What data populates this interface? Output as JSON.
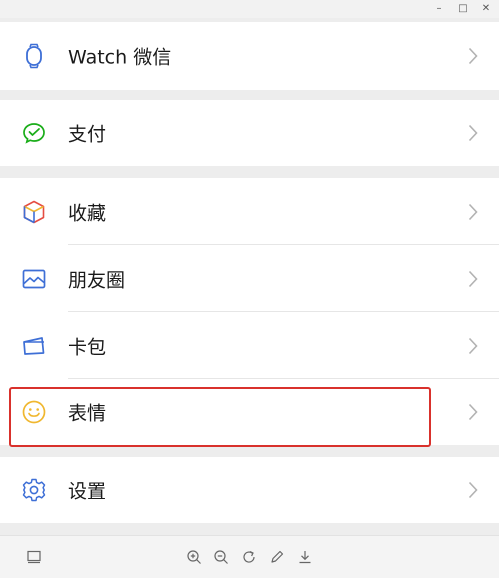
{
  "window": {
    "minimize_glyph": "–",
    "maximize_glyph": "□",
    "close_glyph": "✕"
  },
  "menu": {
    "watch": {
      "label": "Watch 微信",
      "icon": "watch-icon"
    },
    "pay": {
      "label": "支付",
      "icon": "wechat-pay-icon"
    },
    "favorites": {
      "label": "收藏",
      "icon": "cube-icon"
    },
    "moments": {
      "label": "朋友圈",
      "icon": "picture-icon"
    },
    "cards": {
      "label": "卡包",
      "icon": "card-icon"
    },
    "stickers": {
      "label": "表情",
      "icon": "smiley-icon"
    },
    "settings": {
      "label": "设置",
      "icon": "gear-icon"
    }
  },
  "highlighted_item": "stickers",
  "colors": {
    "highlight_border": "#d9312c",
    "icon_blue": "#3e6fd6",
    "icon_green": "#1aad19",
    "icon_yellow": "#f0b72f",
    "chevron": "#b2b2b2"
  },
  "toolbar": {
    "tools": [
      "screen-icon",
      "zoom-in-icon",
      "zoom-out-icon",
      "rotate-icon",
      "edit-icon",
      "download-icon"
    ]
  }
}
